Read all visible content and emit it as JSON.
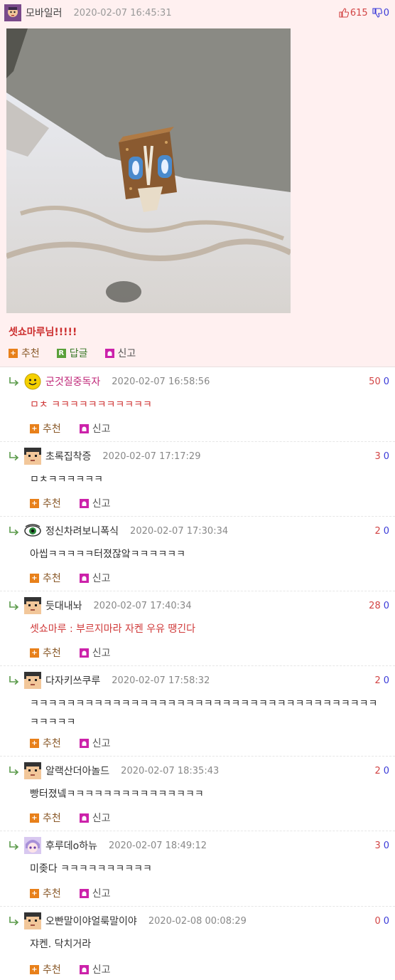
{
  "post": {
    "author": "모바일러",
    "date": "2020-02-07 16:45:31",
    "upvotes": "615",
    "downvotes": "0",
    "text": "셋쇼마루님!!!!!",
    "actions": {
      "recommend": "추천",
      "reply": "답글",
      "report": "신고"
    },
    "reply_icon_letter": "R"
  },
  "comments": [
    {
      "author": "군것질중독자",
      "date": "2020-02-07 16:58:56",
      "up": "50",
      "down": "0",
      "text": "ㅁㅊ ㅋㅋㅋㅋㅋㅋㅋㅋㅋㅋㅋ",
      "avatar": "smiley"
    },
    {
      "author": "초록집착증",
      "date": "2020-02-07 17:17:29",
      "up": "3",
      "down": "0",
      "text": "ㅁㅊㅋㅋㅋㅋㅋㅋ",
      "avatar": "pixel-face"
    },
    {
      "author": "정신차려보니폭식",
      "date": "2020-02-07 17:30:34",
      "up": "2",
      "down": "0",
      "text": "아씹ㅋㅋㅋㅋㅋ터졌잖앜ㅋㅋㅋㅋㅋㅋ",
      "avatar": "eye"
    },
    {
      "author": "듯대내놔",
      "date": "2020-02-07 17:40:34",
      "up": "28",
      "down": "0",
      "text": "셋쇼마루 : 부르지마라 자켄 우유 땡긴다",
      "avatar": "pixel-face"
    },
    {
      "author": "다자키쓰쿠루",
      "date": "2020-02-07 17:58:32",
      "up": "2",
      "down": "0",
      "text": "ㅋㅋㅋㅋㅋㅋㅋㅋㅋㅋㅋㅋㅋㅋㅋㅋㅋㅋㅋㅋㅋㅋㅋㅋㅋㅋㅋㅋㅋㅋㅋㅋㅋㅋㅋㅋㅋㅋㅋㅋㅋㅋㅋ",
      "avatar": "pixel-face"
    },
    {
      "author": "알랙산더아놀드",
      "date": "2020-02-07 18:35:43",
      "up": "2",
      "down": "0",
      "text": "빵터졌넼ㅋㅋㅋㅋㅋㅋㅋㅋㅋㅋㅋㅋㅋㅋㅋ",
      "avatar": "pixel-face"
    },
    {
      "author": "후루데o하뉴",
      "date": "2020-02-07 18:49:12",
      "up": "3",
      "down": "0",
      "text": "미좆다 ㅋㅋㅋㅋㅋㅋㅋㅋㅋㅋ",
      "avatar": "anime"
    },
    {
      "author": "오빤말이야얼룩말이야",
      "date": "2020-02-08 00:08:29",
      "up": "0",
      "down": "0",
      "text": "쟈켄. 닥치거라",
      "avatar": "pixel-face"
    }
  ],
  "colors": {
    "post_bg": "#fff0f0",
    "accent_red": "#d24444",
    "accent_blue": "#3b3bd8"
  }
}
